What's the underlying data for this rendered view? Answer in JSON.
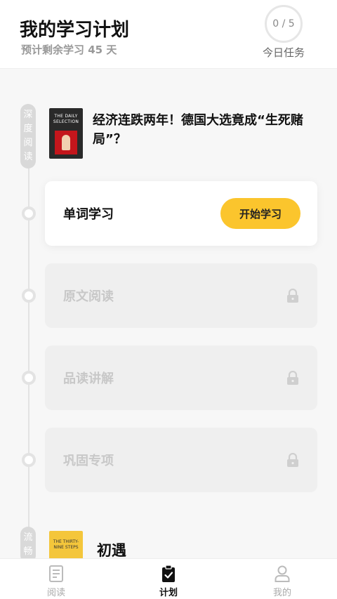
{
  "header": {
    "title": "我的学习计划",
    "subtitle": "预计剩余学习 45 天",
    "progress_text": "0 / 5",
    "progress_label": "今日任务"
  },
  "sections": [
    {
      "tag": "深度阅读",
      "book_title": "经济连跌两年！德国大选竟成“生死赌局”？",
      "cover_text": "THE DAILY SELECTION"
    },
    {
      "tag": "流畅",
      "book_title": "初遇",
      "cover_text": "THE THIRTY-NINE STEPS"
    }
  ],
  "steps": [
    {
      "label": "单词学习",
      "button": "开始学习",
      "locked": false
    },
    {
      "label": "原文阅读",
      "locked": true
    },
    {
      "label": "品读讲解",
      "locked": true
    },
    {
      "label": "巩固专项",
      "locked": true
    }
  ],
  "tabs": [
    {
      "label": "阅读",
      "icon": "reading-icon"
    },
    {
      "label": "计划",
      "icon": "plan-clipboard-icon",
      "active": true
    },
    {
      "label": "我的",
      "icon": "profile-icon"
    }
  ],
  "colors": {
    "accent": "#fbc52d",
    "muted": "#c8c8c8"
  }
}
